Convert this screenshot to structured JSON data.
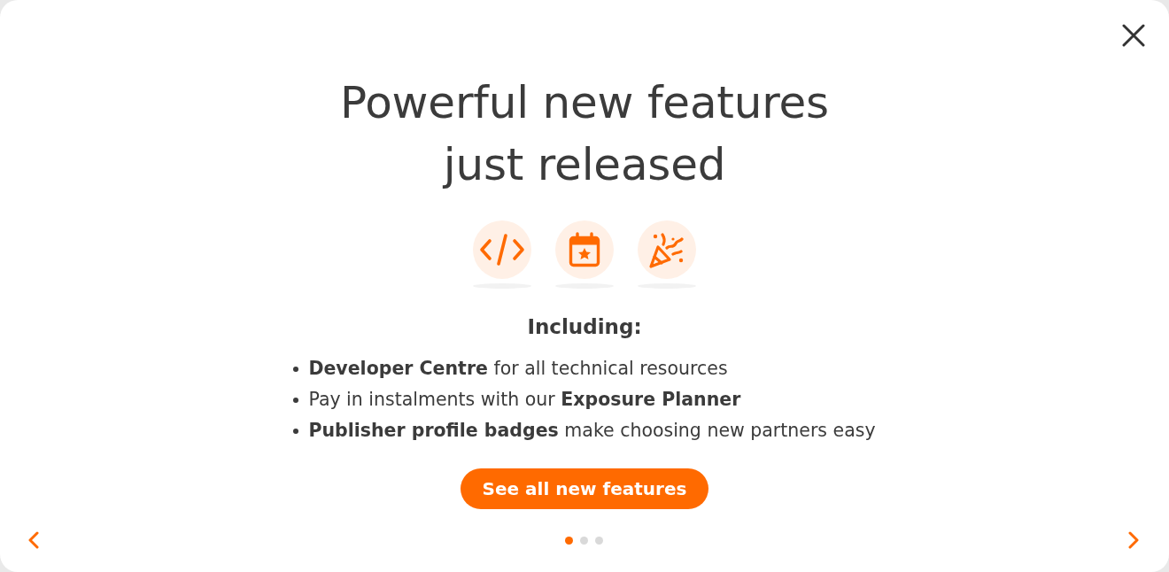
{
  "dialog": {
    "title": "Powerful new features just released",
    "heading": "Including:",
    "items": [
      "**Developer Centre** for all technical resources",
      "Pay in instalments with our **Exposure Planner**",
      "**Publisher profile badges** make choosing new partners easy"
    ],
    "button": "See all new features",
    "pagination": [
      {
        "selected": true
      },
      {
        "selected": false
      },
      {
        "selected": false
      }
    ]
  }
}
